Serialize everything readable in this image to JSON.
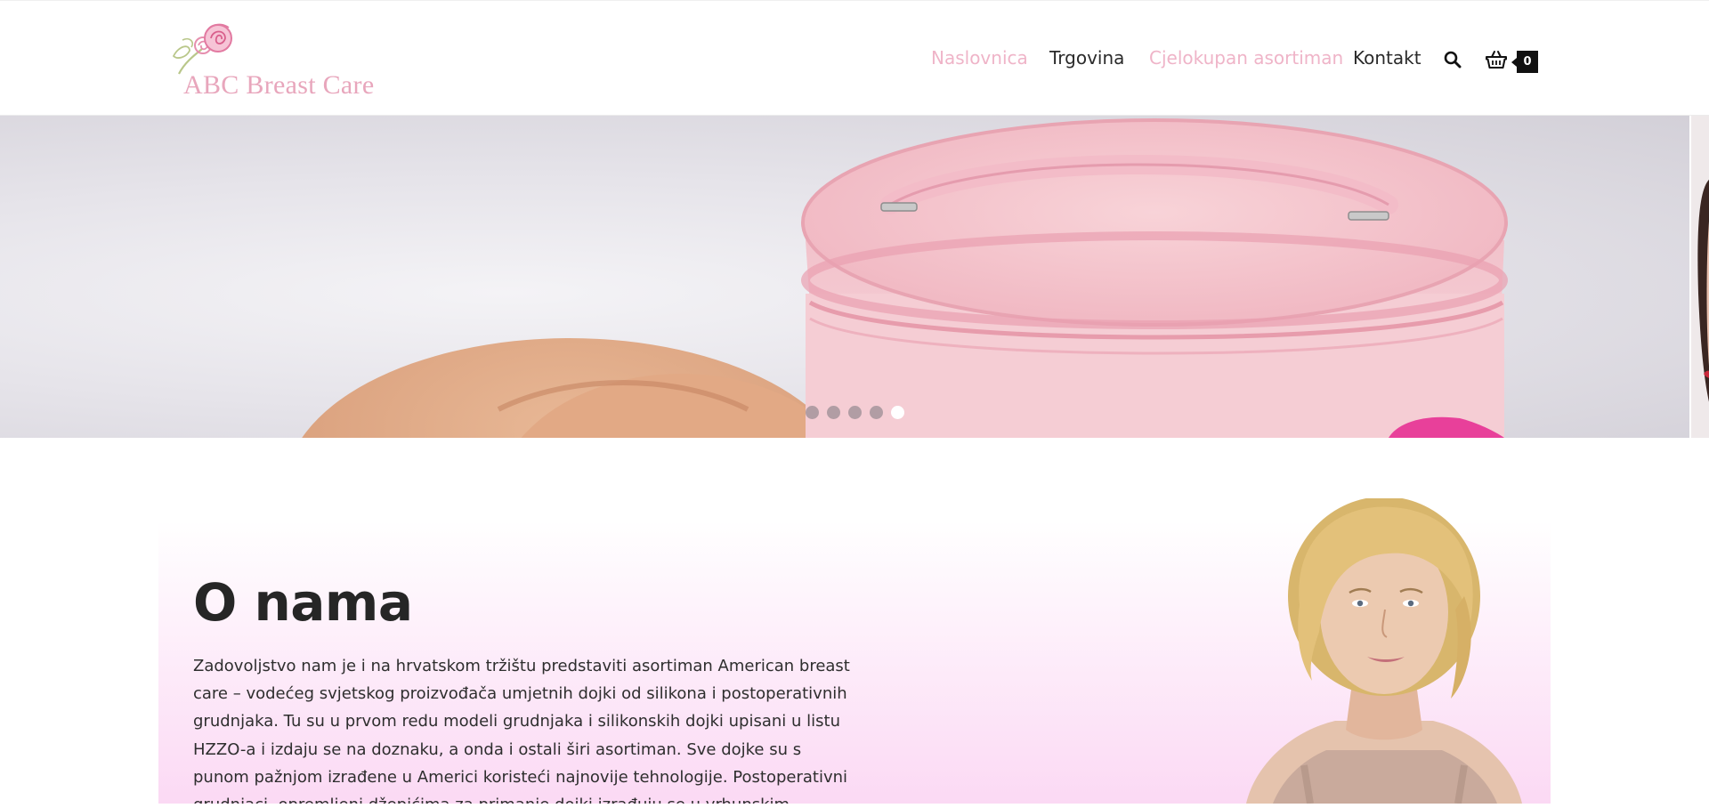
{
  "header": {
    "logo_text": "ABC Breast Care",
    "nav": {
      "home": "Naslovnica",
      "shop": "Trgovina",
      "catalog": "Cjelokupan asortiman",
      "contact": "Kontakt"
    },
    "search_icon": "search-icon",
    "cart_icon": "basket-icon",
    "cart_count": "0"
  },
  "slider": {
    "slide_count": 5,
    "active_slide": 5
  },
  "about": {
    "title": "O nama",
    "text": "Zadovoljstvo nam je i na hrvatskom tržištu predstaviti asortiman American breast care – vodećeg svjetskog proizvođača umjetnih dojki od silikona i postoperativnih grudnjaka. Tu su u prvom redu modeli grudnjaka i silikonskih dojki upisani u listu HZZO-a i izdaju se na doznaku, a onda i ostali širi asortiman. Sve dojke su s punom pažnjom izrađene u Americi koristeći najnovije tehnologije. Postoperativni grudnjaci, opremljeni džepićima za primanje dojki izrađuju se u vrhunskim tvornicama i podliježu strogim kontrolama"
  },
  "colors": {
    "brand_pink": "#e8a6bc",
    "nav_active_pink": "#efb4c8",
    "nav_dark": "#2a2a2a",
    "section_gradient_end": "#fbd9f4"
  }
}
